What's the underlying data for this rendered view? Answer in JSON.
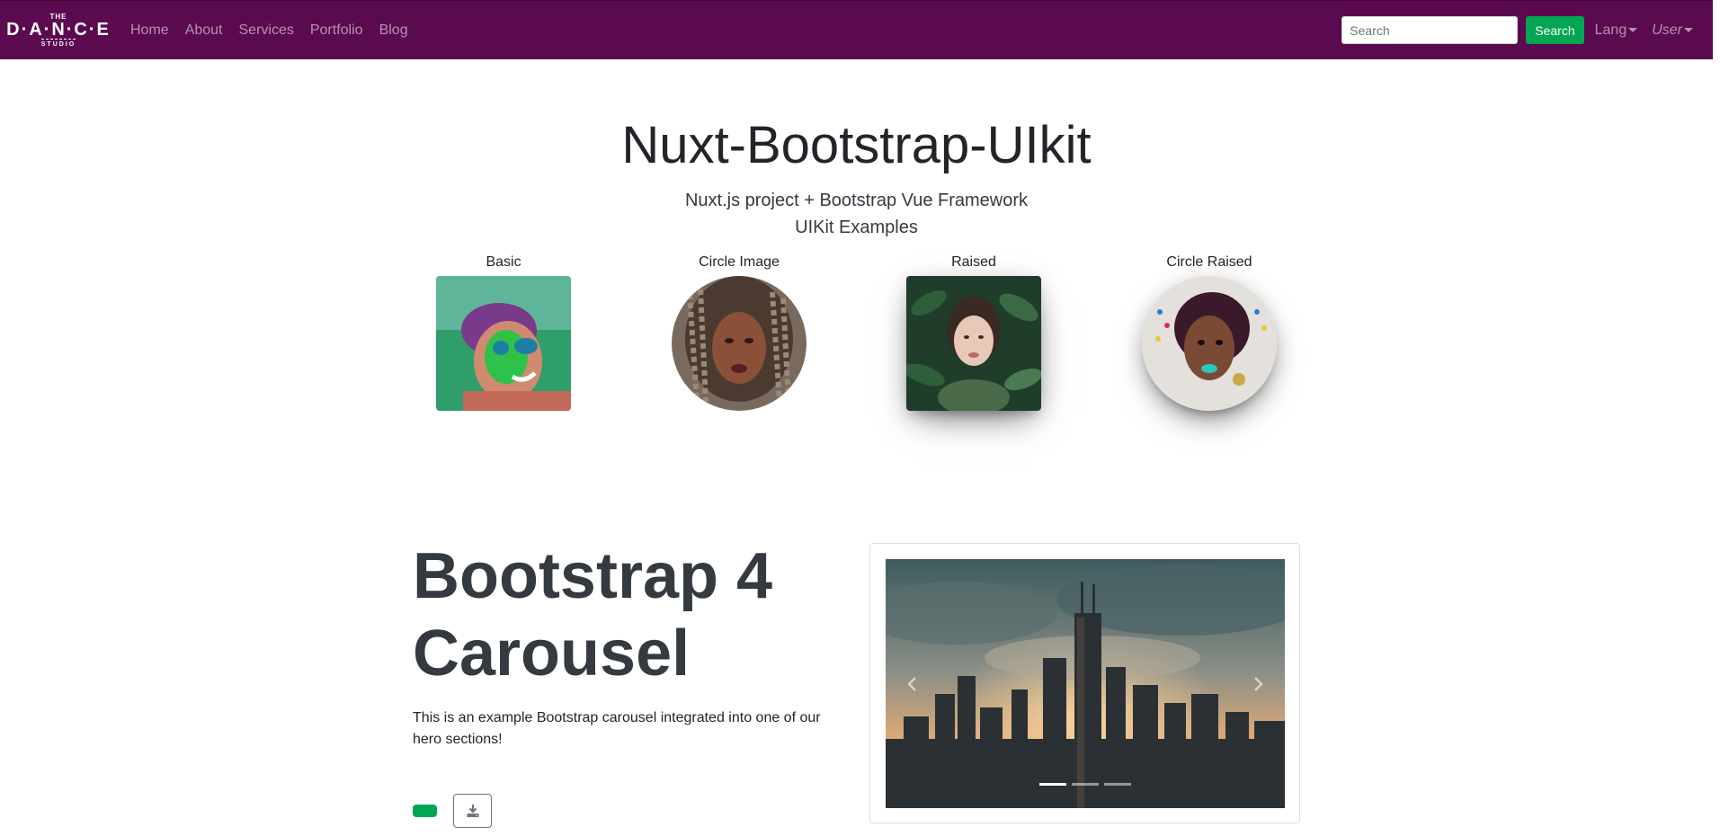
{
  "navbar": {
    "brand": {
      "top": "THE",
      "main": "D·A·N·C·E",
      "bottom": "STUDIO"
    },
    "links": [
      "Home",
      "About",
      "Services",
      "Portfolio",
      "Blog"
    ],
    "search_placeholder": "Search",
    "search_button": "Search",
    "lang_label": "Lang",
    "user_label": "User",
    "bg_color": "#5b0a4f",
    "accent_color": "#00a651"
  },
  "hero": {
    "title": "Nuxt-Bootstrap-UIkit",
    "subtitle_line1": "Nuxt.js project + Bootstrap Vue Framework",
    "subtitle_line2": "UIKit Examples"
  },
  "images": [
    {
      "label": "Basic",
      "icon": "portrait-holi-man-photo"
    },
    {
      "label": "Circle Image",
      "icon": "portrait-braids-woman-photo"
    },
    {
      "label": "Raised",
      "icon": "portrait-leaves-woman-photo"
    },
    {
      "label": "Circle Raised",
      "icon": "portrait-short-hair-woman-photo"
    }
  ],
  "carousel_section": {
    "title": "Bootstrap 4 Carousel",
    "description": "This is an example Bootstrap carousel integrated into one of our hero sections!",
    "download_icon": "download-icon",
    "slide_count": 3,
    "active_slide": 0,
    "slide_image": "city-skyline-sunset-photo"
  }
}
